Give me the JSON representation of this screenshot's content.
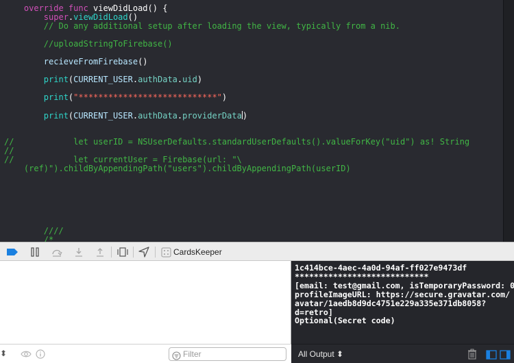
{
  "editor": {
    "lines": [
      {
        "indent": "    ",
        "parts": [
          [
            "kw",
            "override"
          ],
          [
            "kw",
            " func"
          ],
          [
            "plain",
            " viewDidLoad() {"
          ]
        ]
      },
      {
        "indent": "        ",
        "parts": [
          [
            "kw",
            "super"
          ],
          [
            "plain",
            "."
          ],
          [
            "call",
            "viewDidLoad"
          ],
          [
            "plain",
            "()"
          ]
        ]
      },
      {
        "indent": "        ",
        "parts": [
          [
            "cm",
            "// Do any additional setup after loading the view, typically from a nib."
          ]
        ]
      },
      {
        "indent": "",
        "parts": []
      },
      {
        "indent": "        ",
        "parts": [
          [
            "cm",
            "//uploadStringToFirebase()"
          ]
        ]
      },
      {
        "indent": "",
        "parts": []
      },
      {
        "indent": "        ",
        "parts": [
          [
            "proj",
            "recieveFromFirebase"
          ],
          [
            "plain",
            "()"
          ]
        ]
      },
      {
        "indent": "",
        "parts": []
      },
      {
        "indent": "        ",
        "parts": [
          [
            "call",
            "print"
          ],
          [
            "plain",
            "("
          ],
          [
            "proj",
            "CURRENT_USER"
          ],
          [
            "plain",
            "."
          ],
          [
            "mem",
            "authData"
          ],
          [
            "plain",
            "."
          ],
          [
            "mem",
            "uid"
          ],
          [
            "plain",
            ")"
          ]
        ]
      },
      {
        "indent": "",
        "parts": []
      },
      {
        "indent": "        ",
        "parts": [
          [
            "call",
            "print"
          ],
          [
            "plain",
            "("
          ],
          [
            "str",
            "\"****************************\""
          ],
          [
            "plain",
            ")"
          ]
        ]
      },
      {
        "indent": "",
        "parts": []
      },
      {
        "indent": "        ",
        "parts": [
          [
            "call",
            "print"
          ],
          [
            "plain",
            "("
          ],
          [
            "proj",
            "CURRENT_USER"
          ],
          [
            "plain",
            "."
          ],
          [
            "mem",
            "authData"
          ],
          [
            "plain",
            "."
          ],
          [
            "mem",
            "providerData"
          ],
          [
            "cursor",
            ""
          ],
          [
            "plain",
            ")"
          ]
        ]
      },
      {
        "indent": "",
        "parts": []
      },
      {
        "indent": "",
        "parts": []
      },
      {
        "indent": "",
        "parts": [
          [
            "cm",
            "//            let userID = NSUserDefaults.standardUserDefaults().valueForKey(\"uid\") as! String"
          ]
        ]
      },
      {
        "indent": "",
        "parts": [
          [
            "cm",
            "//"
          ]
        ]
      },
      {
        "indent": "",
        "parts": [
          [
            "cm",
            "//            let currentUser = Firebase(url: \"\\"
          ]
        ]
      },
      {
        "indent": "",
        "parts": [
          [
            "cm",
            "    (ref)\").childByAppendingPath(\"users\").childByAppendingPath(userID)"
          ]
        ]
      },
      {
        "indent": "",
        "parts": []
      },
      {
        "indent": "",
        "parts": []
      },
      {
        "indent": "",
        "parts": []
      },
      {
        "indent": "",
        "parts": []
      },
      {
        "indent": "",
        "parts": []
      },
      {
        "indent": "",
        "parts": []
      },
      {
        "indent": "        ",
        "parts": [
          [
            "cm",
            "////"
          ]
        ]
      },
      {
        "indent": "        ",
        "parts": [
          [
            "cm",
            "/*"
          ]
        ]
      }
    ]
  },
  "debug_bar": {
    "app_name": "CardsKeeper"
  },
  "variables": {
    "filter_placeholder": "Filter"
  },
  "console": {
    "output_filter": "All Output ⬍",
    "text": "1c414bce-4aec-4a0d-94af-ff027e9473df\n****************************\n[email: test@gmail.com, isTemporaryPassword: 0,\nprofileImageURL: https://secure.gravatar.com/\navatar/1aedb8d9dc4751e229a335e371db8058?\nd=retro]\nOptional(Secret code)"
  },
  "colors": {
    "editor_bg": "#292a30",
    "keyword": "#d050b8",
    "comment": "#41b645",
    "string": "#fc6a5d",
    "project_symbol": "#b8e7ff",
    "console_bg": "#25262b",
    "accent": "#1a80e0"
  },
  "icons": [
    "breakpoint-toggle-icon",
    "pause-icon",
    "step-over-icon",
    "step-into-icon",
    "step-out-icon",
    "view-hierarchy-icon",
    "location-icon",
    "app-icon",
    "filter-icon",
    "eye-icon",
    "info-icon",
    "trash-icon",
    "split-left-icon",
    "split-right-icon"
  ]
}
